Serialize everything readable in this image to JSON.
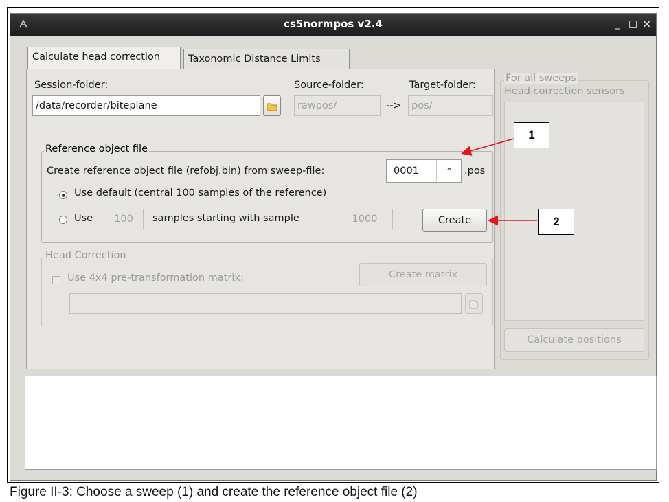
{
  "window": {
    "title": "cs5normpos v2.4",
    "minimize": "_",
    "maximize": "□",
    "close": "×"
  },
  "tabs": [
    {
      "label": "Calculate head correction",
      "active": true
    },
    {
      "label": "Taxonomic Distance Limits",
      "active": false
    }
  ],
  "folders": {
    "session_label": "Session-folder:",
    "session_value": "/data/recorder/biteplane",
    "source_label": "Source-folder:",
    "source_value": "rawpos/",
    "arrow": "-->",
    "target_label": "Target-folder:",
    "target_value": "pos/"
  },
  "reference": {
    "group_title": "Reference object file",
    "create_label": "Create reference object file (refobj.bin) from sweep-file:",
    "sweep_value": "0001",
    "sweep_suffix": ".pos",
    "radio_default_label": "Use default (central 100 samples of the reference)",
    "radio_use_label": "Use",
    "samples_value": "100",
    "samples_text": "samples starting with sample",
    "start_value": "1000",
    "create_button": "Create"
  },
  "head_correction": {
    "group_title": "Head Correction",
    "checkbox_label": "Use 4x4 pre-transformation matrix:",
    "create_matrix_button": "Create matrix",
    "matrix_path": ""
  },
  "right_panel": {
    "group_title": "For all sweeps",
    "sensors_label": "Head correction sensors",
    "calc_button": "Calculate positions"
  },
  "callouts": [
    "1",
    "2"
  ],
  "caption": "Figure II-3: Choose a sweep (1) and create the reference object file (2)",
  "colors": {
    "arrow": "#e8141b",
    "titlebar": "#2a2a2a",
    "window_bg": "#dcdad5"
  }
}
